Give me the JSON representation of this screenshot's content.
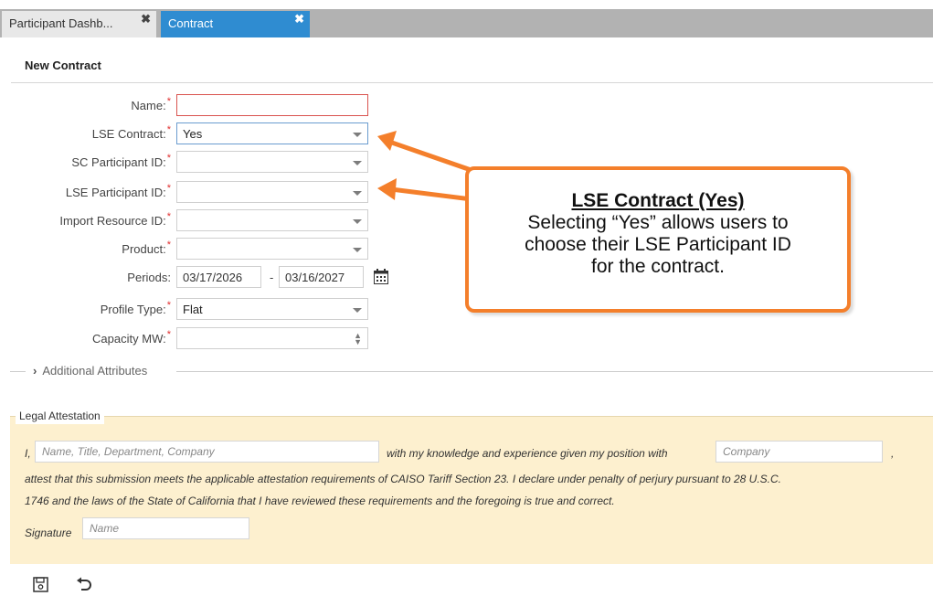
{
  "tabs": [
    {
      "label": "Participant Dashb...",
      "close": "✖"
    },
    {
      "label": "Contract",
      "close": "✖"
    }
  ],
  "page_title": "New Contract",
  "form": {
    "name_label": "Name:",
    "name_value": "",
    "lse_contract_label": "LSE Contract:",
    "lse_contract_value": "Yes",
    "sc_participant_label": "SC Participant ID:",
    "lse_participant_label": "LSE Participant ID:",
    "import_resource_label": "Import Resource ID:",
    "product_label": "Product:",
    "periods_label": "Periods:",
    "period_start": "03/17/2026",
    "period_sep": "-",
    "period_end": "03/16/2027",
    "profile_type_label": "Profile Type:",
    "profile_type_value": "Flat",
    "capacity_label": "Capacity MW:",
    "required_mark": "*"
  },
  "additional_attributes": "Additional Attributes",
  "legal": {
    "title": "Legal Attestation",
    "prefix": "I,",
    "name_placeholder": "Name, Title, Department, Company",
    "middle_text": "with my knowledge and experience given my position with",
    "company_placeholder": "Company",
    "comma": ",",
    "line1": "attest that this submission meets the applicable attestation requirements of CAISO Tariff Section 23. I declare under penalty of perjury pursuant to 28 U.S.C.",
    "line2": "1746 and the laws of the State of California that I have reviewed these requirements and the foregoing is true and correct.",
    "signature_label": "Signature",
    "signature_placeholder": "Name"
  },
  "callout": {
    "heading": "LSE Contract (Yes)",
    "line1": "Selecting “Yes” allows users to",
    "line2": "choose their LSE Participant ID",
    "line3": "for the contract."
  },
  "colors": {
    "accent": "#2f8cd1",
    "callout_border": "#f47f2b",
    "legal_bg": "#fdf0cf",
    "required": "#e03030"
  }
}
